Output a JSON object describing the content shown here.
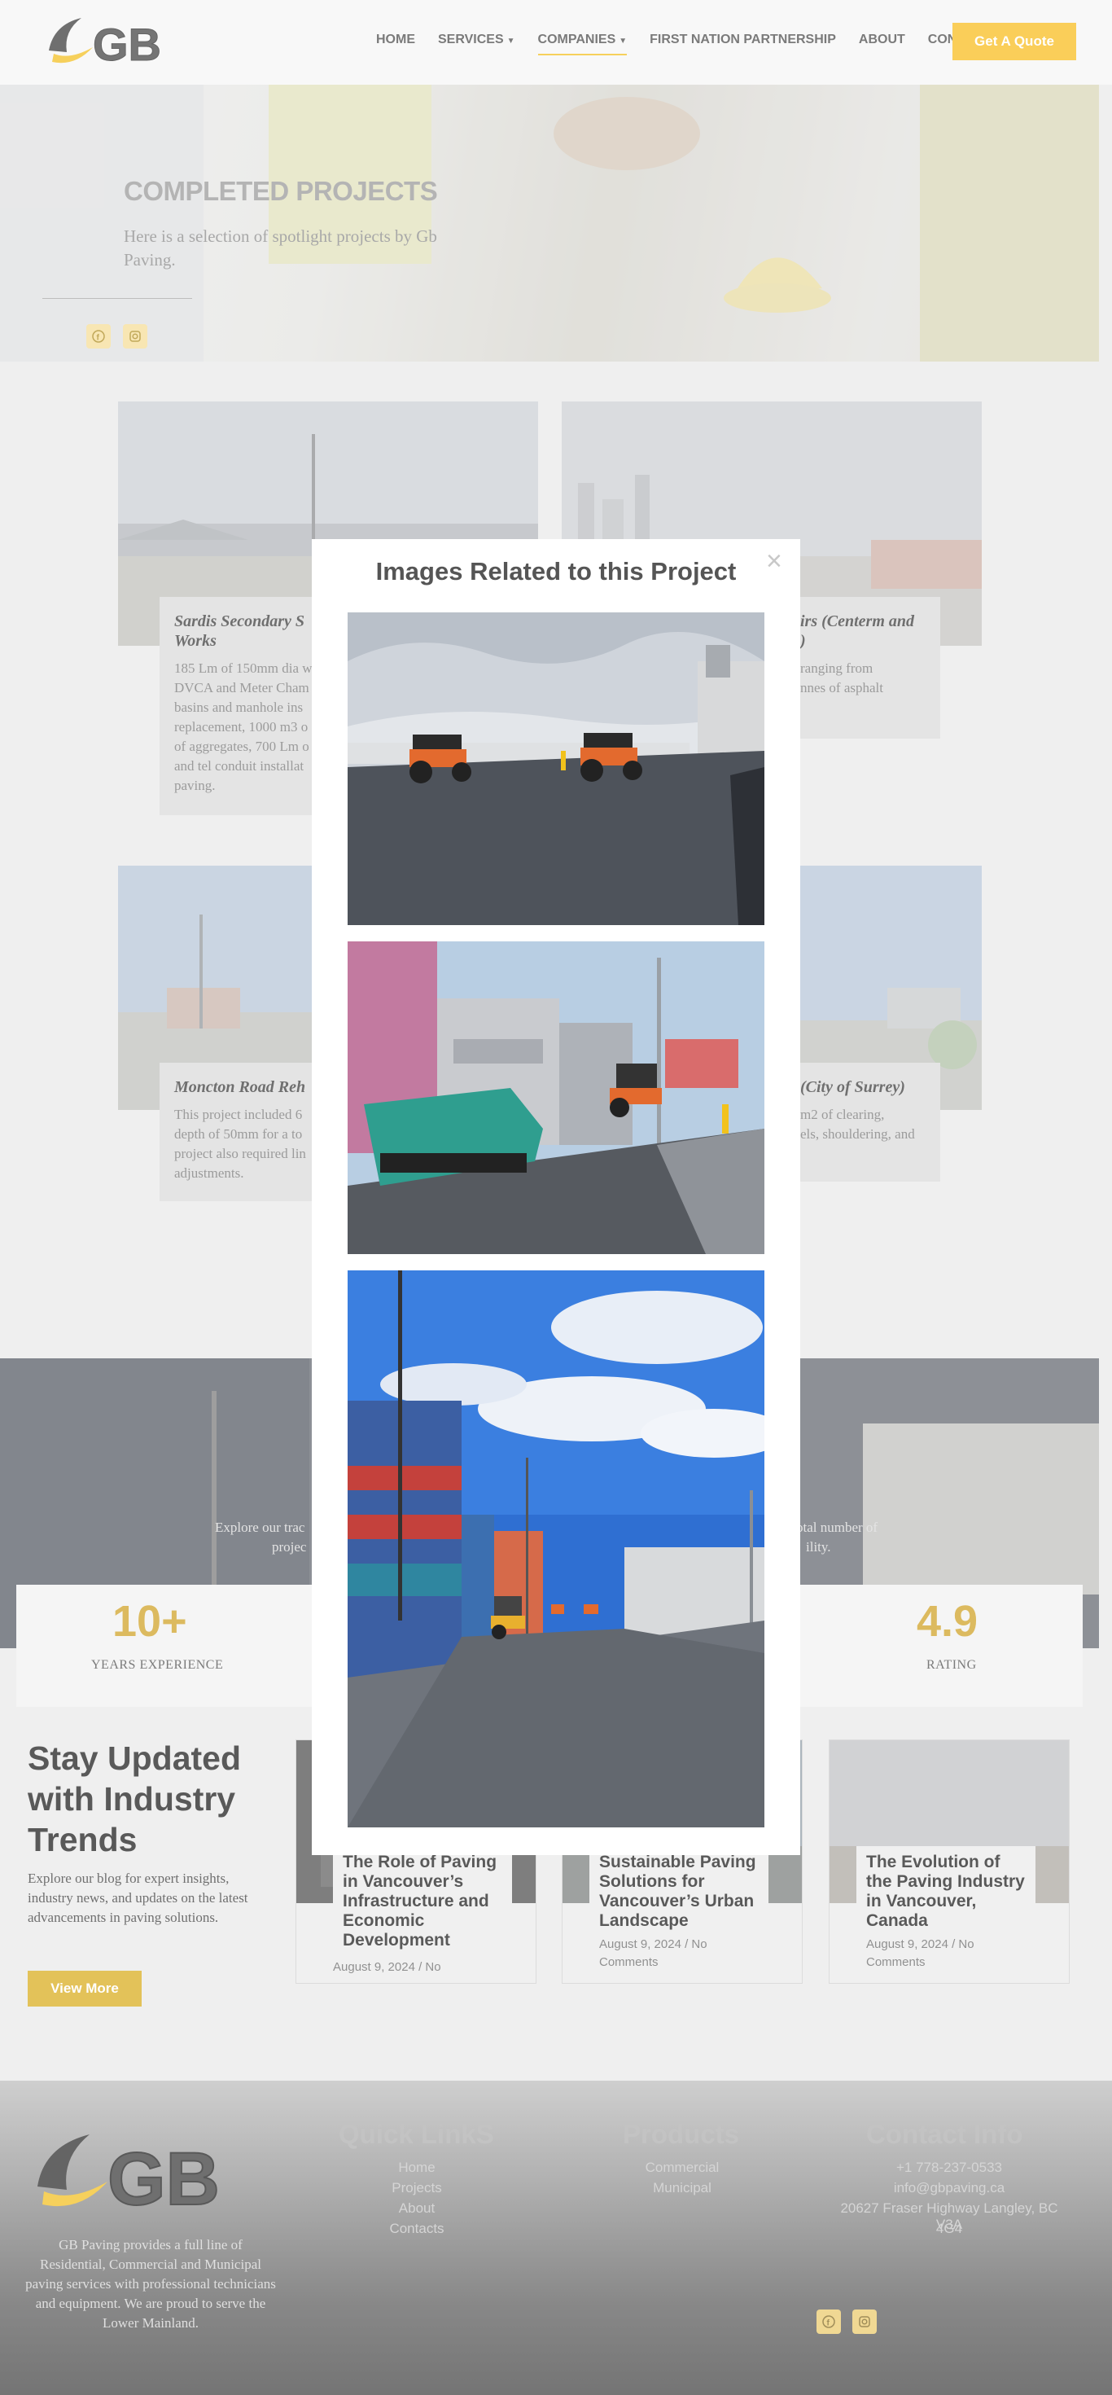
{
  "header": {
    "logo_text": "GB",
    "nav": [
      {
        "label": "HOME",
        "caret": false,
        "active": false
      },
      {
        "label": "SERVICES",
        "caret": true,
        "active": false
      },
      {
        "label": "COMPANIES",
        "caret": true,
        "active": true
      },
      {
        "label": "FIRST NATION PARTNERSHIP",
        "caret": false,
        "active": false
      },
      {
        "label": "ABOUT",
        "caret": false,
        "active": false
      },
      {
        "label": "CONTACT",
        "caret": false,
        "active": false
      }
    ],
    "cta_label": "Get A Quote",
    "accent_color": "#f7b400"
  },
  "hero": {
    "title": "COMPLETED PROJECTS",
    "subtitle": "Here is a selection of spotlight projects by Gb Paving.",
    "social_icons": [
      "facebook-icon",
      "instagram-icon"
    ]
  },
  "projects": [
    {
      "title": "Sardis Secondary S",
      "title2": "Works",
      "desc": [
        "185 Lm of 150mm dia w",
        "DVCA and Meter Cham",
        "basins and manhole ins",
        "replacement, 1000 m3 o",
        "of aggregates, 700 Lm o",
        "and tel conduit installat",
        "paving."
      ]
    },
    {
      "title": "irs (Centerm and",
      "title2": ")",
      "desc": [
        "ranging from",
        "nnes of asphalt"
      ]
    },
    {
      "title": "Moncton Road Reh",
      "desc": [
        "This project included 6",
        "depth of 50mm for a to",
        "project also required lin",
        "adjustments."
      ]
    },
    {
      "title": "(City of Surrey)",
      "desc": [
        "m2 of clearing,",
        "els, shouldering, and"
      ]
    }
  ],
  "stats_band": {
    "left_text": [
      "Explore our trac",
      "projec"
    ],
    "right_text": [
      "otal number of",
      "ility."
    ]
  },
  "stats": [
    {
      "value": "10+",
      "label": "YEARS EXPERIENCE"
    },
    {
      "value": "4.9",
      "label": "RATING"
    }
  ],
  "blog": {
    "title": "Stay Updated with Industry Trends",
    "description": "Explore our blog for expert insights, industry news, and updates on the latest advancements in paving solutions.",
    "button_label": "View More",
    "posts": [
      {
        "title": "The Role of Paving in Vancouver’s Infrastructure and Economic Development",
        "meta": "August 9, 2024 / No"
      },
      {
        "title": "Sustainable Paving Solutions for Vancouver’s Urban Landscape",
        "meta": "August 9, 2024 / No Comments"
      },
      {
        "title": "The Evolution of the Paving Industry in Vancouver, Canada",
        "meta": "August 9, 2024 / No Comments"
      }
    ]
  },
  "footer": {
    "about": "GB Paving provides a full line of Residential, Commercial and Municipal paving services with professional technicians and equipment. We are proud to serve the Lower Mainland.",
    "quick_links_title": "Quick LinkS",
    "quick_links": [
      "Home",
      "Projects",
      "About",
      "Contacts"
    ],
    "products_title": "Products",
    "products": [
      "Commercial",
      "Municipal"
    ],
    "contact_title": "Contact Info",
    "contact": [
      "+1 778-237-0533",
      "info@gbpaving.ca",
      "20627 Fraser Highway Langley, BC V3A",
      "4G4"
    ]
  },
  "modal": {
    "title": "Images Related to this Project",
    "close_label": "×",
    "images": [
      "Two asphalt rollers compacting a road near port silos",
      "Green paver and roller laying asphalt beside shipping containers",
      "Freshly paved road lined with stacked shipping containers under blue sky"
    ]
  }
}
